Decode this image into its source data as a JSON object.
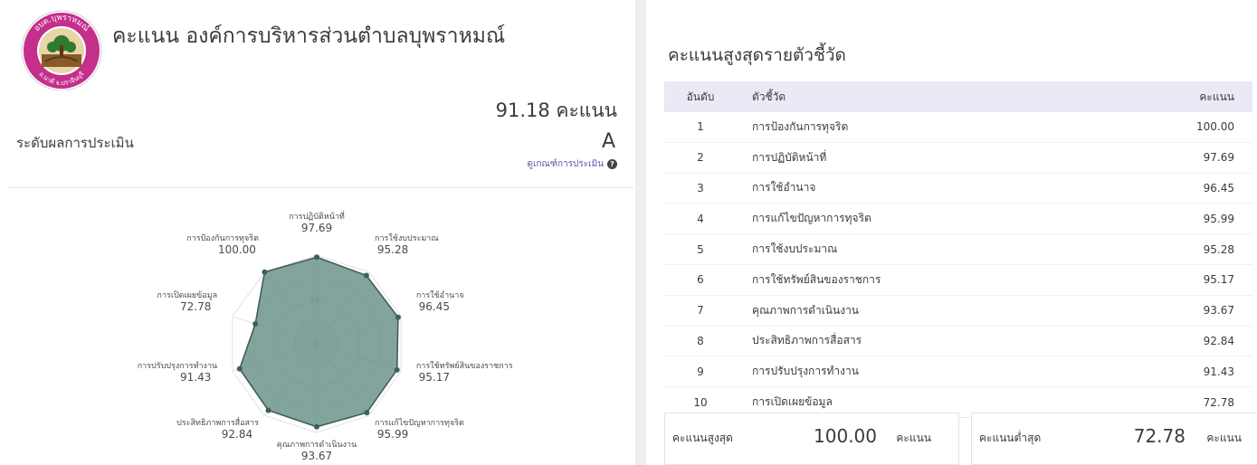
{
  "header": {
    "title": "คะแนน องค์การบริหารส่วนตำบลบุพราหมณ์",
    "score_text": "91.18 คะแนน",
    "grade_label": "ระดับผลการประเมิน",
    "grade": "A",
    "criteria_link": "ดูเกณฑ์การประเมิน"
  },
  "logo": {
    "text_top": "อบต.บุพราหมณ์",
    "text_bottom": "อ.นาดี จ.ปราจีนบุรี"
  },
  "ranking": {
    "title": "คะแนนสูงสุดรายตัวชี้วัด",
    "columns": [
      "อันดับ",
      "ตัวชี้วัด",
      "คะแนน"
    ],
    "rows": [
      {
        "rank": "1",
        "indicator": "การป้องกันการทุจริต",
        "score": "100.00"
      },
      {
        "rank": "2",
        "indicator": "การปฏิบัติหน้าที่",
        "score": "97.69"
      },
      {
        "rank": "3",
        "indicator": "การใช้อำนาจ",
        "score": "96.45"
      },
      {
        "rank": "4",
        "indicator": "การแก้ไขปัญหาการทุจริต",
        "score": "95.99"
      },
      {
        "rank": "5",
        "indicator": "การใช้งบประมาณ",
        "score": "95.28"
      },
      {
        "rank": "6",
        "indicator": "การใช้ทรัพย์สินของราชการ",
        "score": "95.17"
      },
      {
        "rank": "7",
        "indicator": "คุณภาพการดำเนินงาน",
        "score": "93.67"
      },
      {
        "rank": "8",
        "indicator": "ประสิทธิภาพการสื่อสาร",
        "score": "92.84"
      },
      {
        "rank": "9",
        "indicator": "การปรับปรุงการทำงาน",
        "score": "91.43"
      },
      {
        "rank": "10",
        "indicator": "การเปิดเผยข้อมูล",
        "score": "72.78"
      }
    ]
  },
  "summary": {
    "max_label": "คะแนนสูงสุด",
    "max_value": "100.00",
    "min_label": "คะแนนต่ำสุด",
    "min_value": "72.78",
    "unit": "คะแนน"
  },
  "colors": {
    "radar_fill": "#5f8a80",
    "radar_stroke": "#3f5f57",
    "header_row": "#ece8f5",
    "link": "#6a4fa3"
  },
  "chart_data": {
    "type": "radar",
    "categories": [
      "การปฏิบัติหน้าที่",
      "การใช้งบประมาณ",
      "การใช้อำนาจ",
      "การใช้ทรัพย์สินของราชการ",
      "การแก้ไขปัญหาการทุจริต",
      "คุณภาพการดำเนินงาน",
      "ประสิทธิภาพการสื่อสาร",
      "การปรับปรุงการทำงาน",
      "การเปิดเผยข้อมูล",
      "การป้องกันการทุจริต"
    ],
    "values": [
      97.69,
      95.28,
      96.45,
      95.17,
      95.99,
      93.67,
      92.84,
      91.43,
      72.78,
      100.0
    ],
    "value_labels": [
      "97.69",
      "95.28",
      "96.45",
      "95.17",
      "95.99",
      "93.67",
      "92.84",
      "91.43",
      "72.78",
      "100.00"
    ],
    "range": [
      0,
      100
    ],
    "ticks": [
      "0",
      "50"
    ],
    "grid": true
  }
}
